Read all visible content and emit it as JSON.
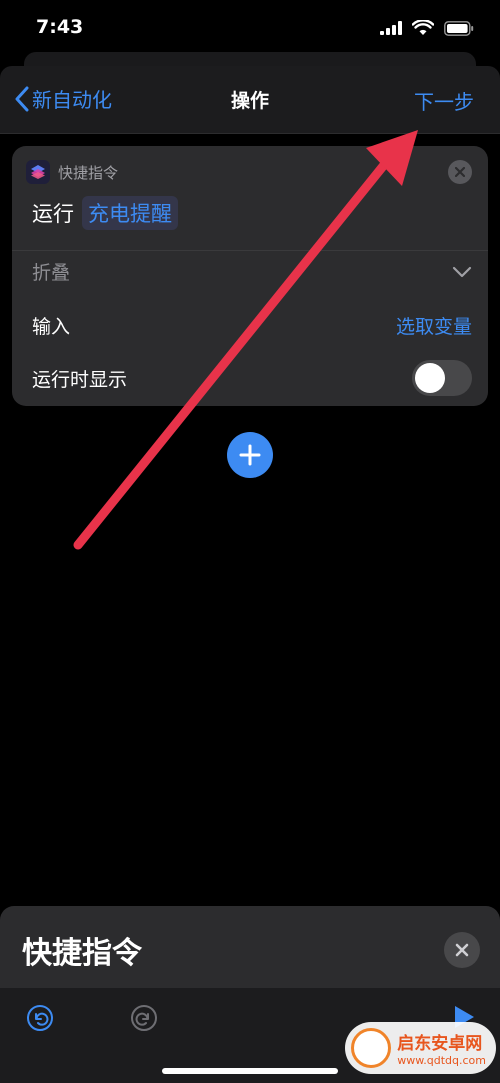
{
  "status_bar": {
    "time": "7:43"
  },
  "nav": {
    "back_label": "新自动化",
    "title": "操作",
    "next_label": "下一步"
  },
  "action_card": {
    "app_name": "快捷指令",
    "verb": "运行",
    "shortcut_name": "充电提醒",
    "collapse_label": "折叠",
    "input_label": "输入",
    "input_value": "选取变量",
    "show_when_run_label": "运行时显示",
    "show_when_run_on": false
  },
  "bottom_panel": {
    "title": "快捷指令"
  },
  "watermark": {
    "name": "启东安卓网",
    "url": "www.qdtdq.com"
  },
  "colors": {
    "accent": "#3d8bf2",
    "annotation": "#e8334a",
    "card_bg": "#2c2c2e",
    "panel_bg": "#1c1c1e"
  },
  "icons": [
    "chevron-left-icon",
    "close-icon",
    "chevron-down-icon",
    "plus-icon",
    "undo-icon",
    "redo-icon",
    "play-icon",
    "shortcuts-app-icon",
    "signal-icon",
    "wifi-icon",
    "battery-icon"
  ]
}
